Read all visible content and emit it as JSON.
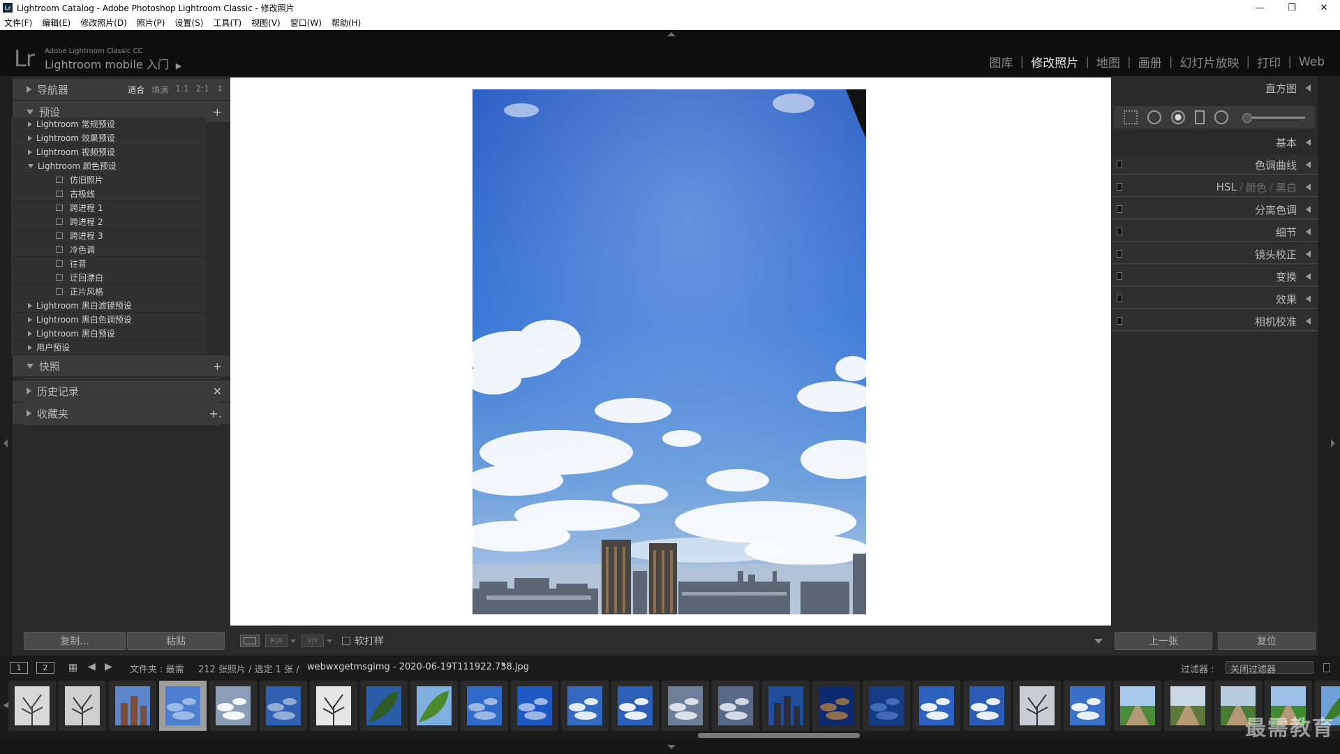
{
  "window": {
    "title": "Lightroom Catalog - Adobe Photoshop Lightroom Classic - 修改照片",
    "badge": "Lr",
    "controls": [
      "—",
      "❐",
      "✕"
    ]
  },
  "menu": [
    "文件(F)",
    "编辑(E)",
    "修改照片(D)",
    "照片(P)",
    "设置(S)",
    "工具(T)",
    "视图(V)",
    "窗口(W)",
    "帮助(H)"
  ],
  "identity": {
    "logo": "Lr",
    "line1": "Adobe Lightroom Classic CC",
    "line2": "Lightroom mobile 入门"
  },
  "modules": [
    {
      "label": "图库",
      "active": false
    },
    {
      "label": "修改照片",
      "active": true
    },
    {
      "label": "地图",
      "active": false
    },
    {
      "label": "画册",
      "active": false
    },
    {
      "label": "幻灯片放映",
      "active": false
    },
    {
      "label": "打印",
      "active": false
    },
    {
      "label": "Web",
      "active": false
    }
  ],
  "left_panel": {
    "navigator": {
      "title": "导航器",
      "zoom": [
        "适合",
        "填满",
        "1:1",
        "2:1"
      ],
      "zoom_selected": "适合"
    },
    "presets": {
      "title": "预设",
      "add": "+",
      "items": [
        {
          "label": "Lightroom 常规预设",
          "kind": "folder",
          "open": false
        },
        {
          "label": "Lightroom 效果预设",
          "kind": "folder",
          "open": false
        },
        {
          "label": "Lightroom 视频预设",
          "kind": "folder",
          "open": false
        },
        {
          "label": "Lightroom 颜色预设",
          "kind": "folder",
          "open": true
        },
        {
          "label": "仿旧照片",
          "kind": "preset"
        },
        {
          "label": "古极线",
          "kind": "preset"
        },
        {
          "label": "跨进程 1",
          "kind": "preset"
        },
        {
          "label": "跨进程 2",
          "kind": "preset"
        },
        {
          "label": "跨进程 3",
          "kind": "preset"
        },
        {
          "label": "冷色调",
          "kind": "preset"
        },
        {
          "label": "往昔",
          "kind": "preset"
        },
        {
          "label": "迂回漂白",
          "kind": "preset"
        },
        {
          "label": "正片风格",
          "kind": "preset"
        },
        {
          "label": "Lightroom 黑白滤镜预设",
          "kind": "folder",
          "open": false
        },
        {
          "label": "Lightroom 黑白色调预设",
          "kind": "folder",
          "open": false
        },
        {
          "label": "Lightroom 黑白预设",
          "kind": "folder",
          "open": false
        },
        {
          "label": "用户预设",
          "kind": "folder",
          "open": false
        }
      ]
    },
    "snapshots": {
      "title": "快照",
      "action": "+"
    },
    "history": {
      "title": "历史记录",
      "action": "✕"
    },
    "collections": {
      "title": "收藏夹",
      "action": "+."
    },
    "copy_button": "复制...",
    "paste_button": "粘贴"
  },
  "right_panel": {
    "histogram": "直方图",
    "basic": "基本",
    "sections": [
      {
        "label": "色调曲线"
      },
      {
        "label": "HSL / 颜色 / 黑白",
        "parts": [
          "HSL",
          "颜色",
          "黑白"
        ]
      },
      {
        "label": "分离色调"
      },
      {
        "label": "细节"
      },
      {
        "label": "镜头校正"
      },
      {
        "label": "变换"
      },
      {
        "label": "效果"
      },
      {
        "label": "相机校准"
      }
    ],
    "prev_button": "上一张",
    "reset_button": "复位"
  },
  "toolbar": {
    "view_icon": "loupe-view-icon",
    "before_after_ra": "R|A",
    "before_after_yy": "Y|Y",
    "soft_proof_label": "软打样"
  },
  "filmbar": {
    "screen1": "1",
    "screen2": "2",
    "folder_label": "文件夹 : 最需",
    "count_label": "212 张照片 / 选定 1 张 /",
    "filename": "webwxgetmsgimg - 2020-06-19T111922.738.jpg",
    "filter_label": "过滤器 :",
    "filter_value": "关闭过滤器"
  },
  "filmstrip": {
    "selected_index": 3,
    "thumbs": [
      {
        "kind": "tree",
        "colors": [
          "#d9d9d9",
          "#444"
        ]
      },
      {
        "kind": "tree",
        "colors": [
          "#cfcfcf",
          "#3a3a3a"
        ]
      },
      {
        "kind": "building",
        "colors": [
          "#5c86c9",
          "#7a4e3a"
        ]
      },
      {
        "kind": "sky",
        "colors": [
          "#4d7fd1",
          "#cfe0f5"
        ]
      },
      {
        "kind": "cloud",
        "colors": [
          "#8a9eb8",
          "#ffffff"
        ]
      },
      {
        "kind": "sky",
        "colors": [
          "#2f5fb0",
          "#d2dff0"
        ]
      },
      {
        "kind": "tree",
        "colors": [
          "#e6e6e6",
          "#333"
        ]
      },
      {
        "kind": "leaf",
        "colors": [
          "#2a5da8",
          "#2f5a2a"
        ]
      },
      {
        "kind": "leaf",
        "colors": [
          "#7fb0e0",
          "#4a8a2c"
        ]
      },
      {
        "kind": "sky",
        "colors": [
          "#2f6ac8",
          "#e4edf8"
        ]
      },
      {
        "kind": "sky",
        "colors": [
          "#1e58c2",
          "#f0f5fc"
        ]
      },
      {
        "kind": "cloud",
        "colors": [
          "#3569c0",
          "#f5f8fc"
        ]
      },
      {
        "kind": "cloud",
        "colors": [
          "#2c5fb7",
          "#ffffff"
        ]
      },
      {
        "kind": "cloud",
        "colors": [
          "#6d7f98",
          "#e8ecf2"
        ]
      },
      {
        "kind": "cloud",
        "colors": [
          "#566a88",
          "#dfe5ee"
        ]
      },
      {
        "kind": "building",
        "colors": [
          "#1f4f9c",
          "#2d2d3a"
        ]
      },
      {
        "kind": "sky",
        "colors": [
          "#0c2a6e",
          "#e59a3a"
        ]
      },
      {
        "kind": "sky",
        "colors": [
          "#133b86",
          "#5f8fd0"
        ]
      },
      {
        "kind": "cloud",
        "colors": [
          "#2d62c0",
          "#ffffff"
        ]
      },
      {
        "kind": "cloud",
        "colors": [
          "#2a5cb8",
          "#ffffff"
        ]
      },
      {
        "kind": "tree",
        "colors": [
          "#c9ced6",
          "#333"
        ]
      },
      {
        "kind": "cloud",
        "colors": [
          "#3a70c8",
          "#ffffff"
        ]
      },
      {
        "kind": "road",
        "colors": [
          "#a8c8ec",
          "#4b8a3a"
        ]
      },
      {
        "kind": "road",
        "colors": [
          "#c9d6e4",
          "#5e7a3a"
        ]
      },
      {
        "kind": "road",
        "colors": [
          "#b8cce0",
          "#4a7a34"
        ]
      },
      {
        "kind": "road",
        "colors": [
          "#9cc0e8",
          "#3f8a30"
        ]
      },
      {
        "kind": "leaf",
        "colors": [
          "#6fa0d8",
          "#3f7a2a"
        ]
      }
    ]
  },
  "watermark": "最需教育"
}
